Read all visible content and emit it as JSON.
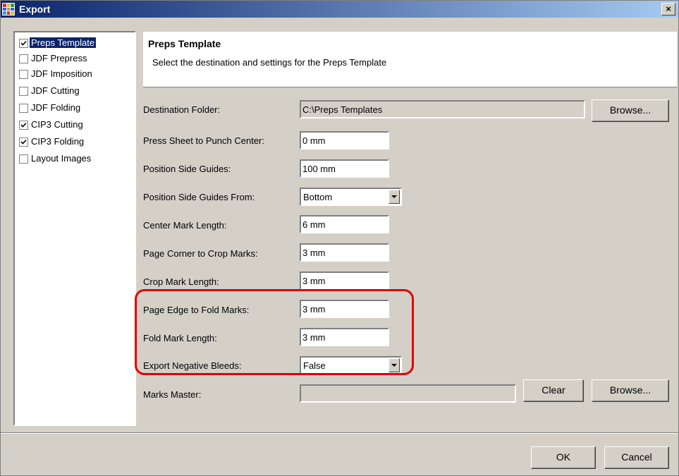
{
  "window": {
    "title": "Export",
    "close_glyph": "×"
  },
  "sidebar": {
    "items": [
      {
        "label": "Preps Template",
        "checked": true,
        "selected": true
      },
      {
        "label": "JDF Prepress",
        "checked": false,
        "selected": false
      },
      {
        "label": "JDF Imposition",
        "checked": false,
        "selected": false
      },
      {
        "label": "JDF Cutting",
        "checked": false,
        "selected": false
      },
      {
        "label": "JDF Folding",
        "checked": false,
        "selected": false
      },
      {
        "label": "CIP3 Cutting",
        "checked": true,
        "selected": false
      },
      {
        "label": "CIP3 Folding",
        "checked": true,
        "selected": false
      },
      {
        "label": "Layout Images",
        "checked": false,
        "selected": false
      }
    ]
  },
  "header": {
    "title": "Preps Template",
    "subtitle": "Select the destination and settings for the Preps Template"
  },
  "form": {
    "destination_folder": {
      "label": "Destination Folder:",
      "value": "C:\\Preps Templates",
      "browse": "Browse..."
    },
    "press_sheet": {
      "label": "Press Sheet to Punch Center:",
      "value": "0 mm"
    },
    "side_guides": {
      "label": "Position Side Guides:",
      "value": "100 mm"
    },
    "side_guides_from": {
      "label": "Position Side Guides From:",
      "value": "Bottom"
    },
    "center_mark": {
      "label": "Center Mark Length:",
      "value": "6 mm"
    },
    "corner_crop": {
      "label": "Page Corner to Crop Marks:",
      "value": "3 mm"
    },
    "crop_length": {
      "label": "Crop Mark Length:",
      "value": "3 mm"
    },
    "edge_fold": {
      "label": "Page Edge to Fold Marks:",
      "value": "3 mm"
    },
    "fold_length": {
      "label": "Fold Mark Length:",
      "value": "3 mm"
    },
    "neg_bleeds": {
      "label": "Export Negative Bleeds:",
      "value": "False"
    },
    "marks_master": {
      "label": "Marks Master:",
      "value": "",
      "clear": "Clear",
      "browse": "Browse..."
    }
  },
  "footer": {
    "ok": "OK",
    "cancel": "Cancel"
  },
  "colors": {
    "title_start": "#0a246a",
    "title_end": "#a6caf0",
    "highlight": "#e00000",
    "selection": "#0a246a"
  }
}
